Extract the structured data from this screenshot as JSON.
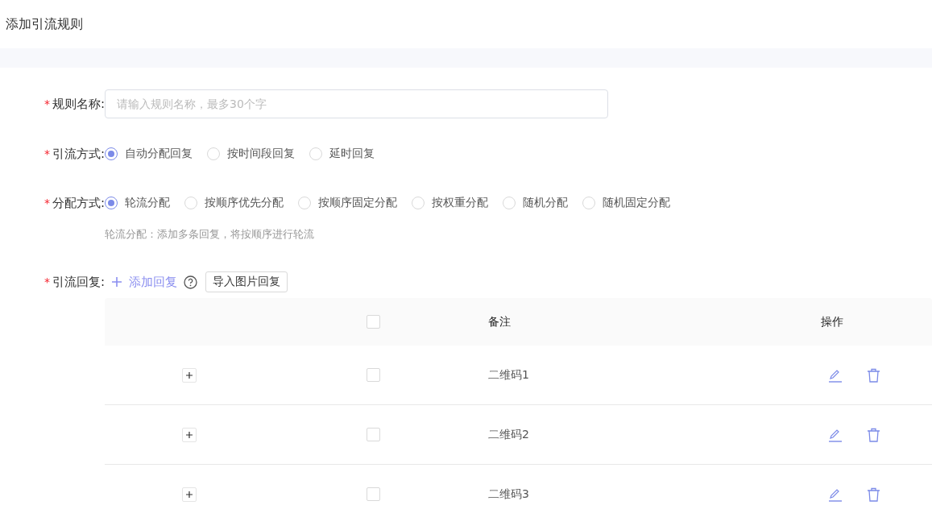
{
  "page_title": "添加引流规则",
  "form": {
    "rule_name": {
      "label": "规则名称:",
      "required_mark": "*",
      "placeholder": "请输入规则名称，最多30个字"
    },
    "traffic_mode": {
      "label": "引流方式:",
      "required_mark": "*",
      "options": [
        {
          "label": "自动分配回复",
          "selected": true
        },
        {
          "label": "按时间段回复",
          "selected": false
        },
        {
          "label": "延时回复",
          "selected": false
        }
      ]
    },
    "distribution_mode": {
      "label": "分配方式:",
      "required_mark": "*",
      "options": [
        {
          "label": "轮流分配",
          "selected": true
        },
        {
          "label": "按顺序优先分配",
          "selected": false
        },
        {
          "label": "按顺序固定分配",
          "selected": false
        },
        {
          "label": "按权重分配",
          "selected": false
        },
        {
          "label": "随机分配",
          "selected": false
        },
        {
          "label": "随机固定分配",
          "selected": false
        }
      ],
      "hint": "轮流分配：添加多条回复，将按顺序进行轮流"
    },
    "replies": {
      "label": "引流回复:",
      "required_mark": "*",
      "add_link": "添加回复",
      "import_button": "导入图片回复",
      "table": {
        "header_checked": false,
        "columns": [
          "备注",
          "操作"
        ],
        "rows": [
          {
            "note": "二维码1",
            "checked": false
          },
          {
            "note": "二维码2",
            "checked": false
          },
          {
            "note": "二维码3",
            "checked": false
          }
        ]
      }
    }
  }
}
